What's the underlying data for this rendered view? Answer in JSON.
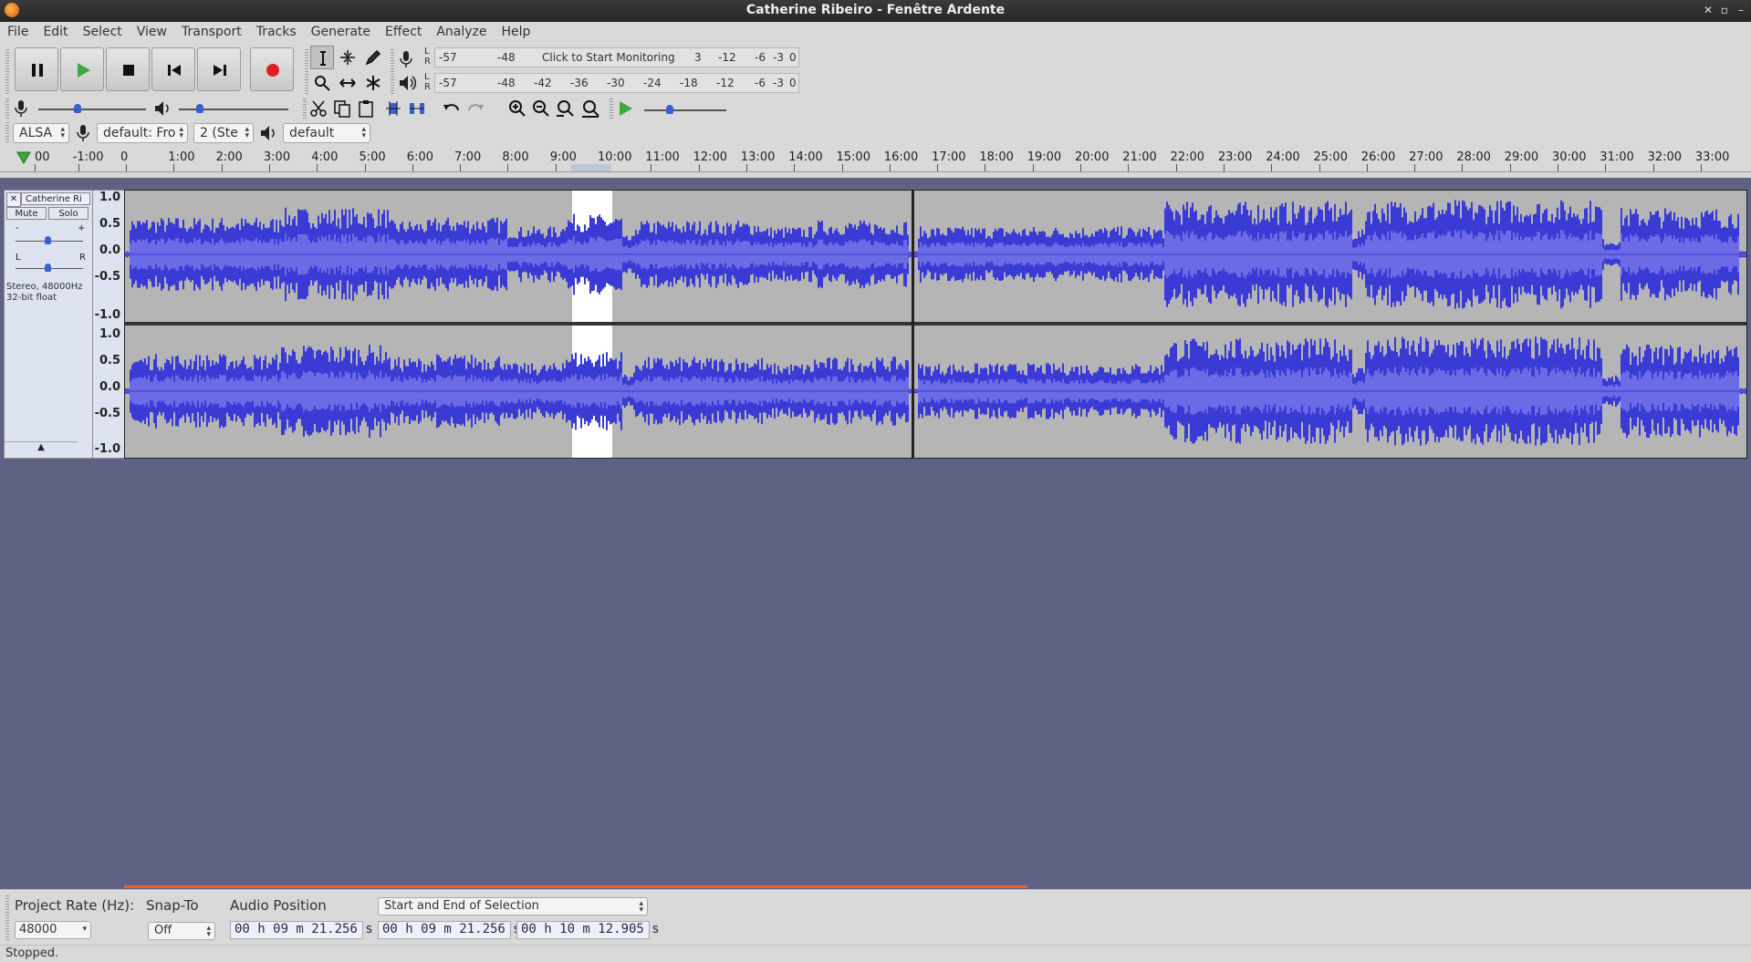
{
  "window": {
    "title": "Catherine Ribeiro - Fenêtre Ardente"
  },
  "menu": [
    "File",
    "Edit",
    "Select",
    "View",
    "Transport",
    "Tracks",
    "Generate",
    "Effect",
    "Analyze",
    "Help"
  ],
  "transport": {
    "buttons": [
      {
        "name": "pause-button",
        "icon": "pause-icon"
      },
      {
        "name": "play-button",
        "icon": "play-icon"
      },
      {
        "name": "stop-button",
        "icon": "stop-icon"
      },
      {
        "name": "skip-to-start-button",
        "icon": "skip-start-icon"
      },
      {
        "name": "skip-to-end-button",
        "icon": "skip-end-icon"
      },
      {
        "name": "record-button",
        "icon": "record-icon"
      }
    ]
  },
  "meters": {
    "record_ticks": [
      "-57",
      "-48",
      "3",
      "-12",
      "-6",
      "-3",
      "0"
    ],
    "record_message": "Click to Start Monitoring",
    "playback_ticks": [
      "-57",
      "-48",
      "-42",
      "-36",
      "-30",
      "-24",
      "-18",
      "-12",
      "-6",
      "-3",
      "0"
    ],
    "lr_left": "L",
    "lr_right": "R"
  },
  "device": {
    "host": "ALSA",
    "recording_device": "default: Fro",
    "channels": "2 (Ste",
    "playback_device": "default"
  },
  "ruler": {
    "labels": [
      "00",
      "-1:00",
      "0",
      "1:00",
      "2:00",
      "3:00",
      "4:00",
      "5:00",
      "6:00",
      "7:00",
      "8:00",
      "9:00",
      "10:00",
      "11:00",
      "12:00",
      "13:00",
      "14:00",
      "15:00",
      "16:00",
      "17:00",
      "18:00",
      "19:00",
      "20:00",
      "21:00",
      "22:00",
      "23:00",
      "24:00",
      "25:00",
      "26:00",
      "27:00",
      "28:00",
      "29:00",
      "30:00",
      "31:00",
      "32:00",
      "33:00"
    ]
  },
  "track": {
    "name": "Catherine Ri",
    "mute_label": "Mute",
    "solo_label": "Solo",
    "gain_min": "-",
    "gain_max": "+",
    "pan_left": "L",
    "pan_right": "R",
    "info_line1": "Stereo, 48000Hz",
    "info_line2": "32-bit float",
    "vruler": [
      "1.0",
      "0.5",
      "0.0",
      "-0.5",
      "-1.0"
    ],
    "wave_color": "#3a3ad4",
    "rms_color": "#6b6be6",
    "selection_color": "#ffffff"
  },
  "selection_toolbar": {
    "project_rate_label": "Project Rate (Hz):",
    "project_rate_value": "48000",
    "snap_label": "Snap-To",
    "snap_value": "Off",
    "audio_position_label": "Audio Position",
    "selection_mode": "Start and End of Selection",
    "audio_position": "00 h 09 m 21.256 s",
    "selection_start": "00 h 09 m 21.256 s",
    "selection_end": "00 h 10 m 12.905 s"
  },
  "status": {
    "text": "Stopped."
  }
}
